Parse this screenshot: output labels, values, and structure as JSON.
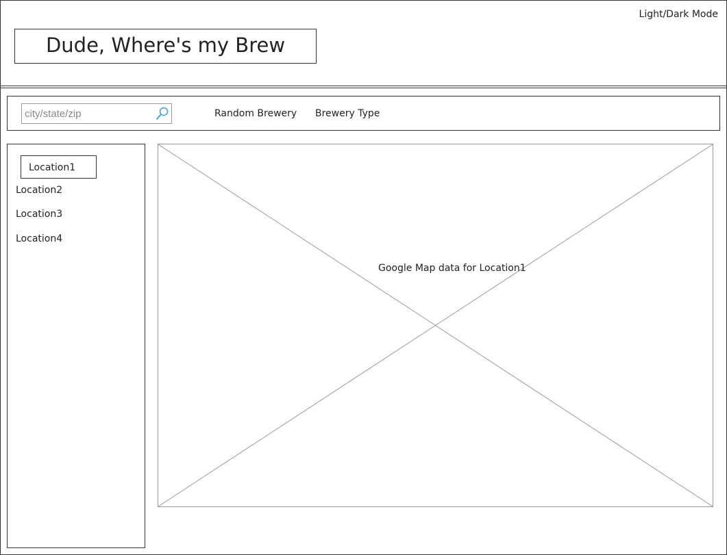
{
  "header": {
    "title": "Dude, Where's my Brew",
    "theme_toggle_label": "Light/Dark Mode"
  },
  "navbar": {
    "search_placeholder": "city/state/zip",
    "random_label": "Random Brewery",
    "type_label": "Brewery Type"
  },
  "sidebar": {
    "items": [
      {
        "label": "Location1",
        "selected": true
      },
      {
        "label": "Location2",
        "selected": false
      },
      {
        "label": "Location3",
        "selected": false
      },
      {
        "label": "Location4",
        "selected": false
      }
    ]
  },
  "map": {
    "label": "Google Map data for Location1"
  },
  "icons": {
    "search": "search-icon"
  },
  "colors": {
    "search_icon": "#3b9fd6",
    "lines": "#333333"
  }
}
